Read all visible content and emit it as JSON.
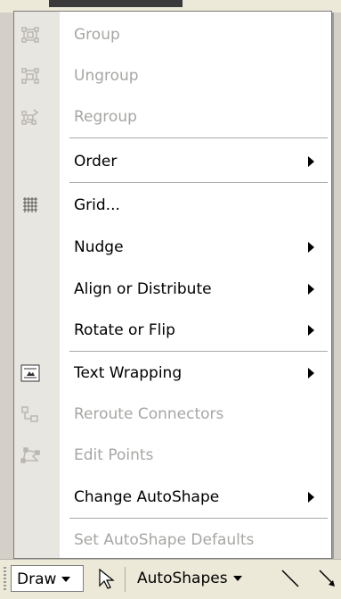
{
  "menu": {
    "items": [
      {
        "label": "Group",
        "icon": "group-icon",
        "disabled": true,
        "submenu": false
      },
      {
        "label": "Ungroup",
        "icon": "ungroup-icon",
        "disabled": true,
        "submenu": false
      },
      {
        "label": "Regroup",
        "icon": "regroup-icon",
        "disabled": true,
        "submenu": false
      },
      {
        "label": "Order",
        "icon": "",
        "disabled": false,
        "submenu": true
      },
      {
        "label": "Grid...",
        "icon": "grid-icon",
        "disabled": false,
        "submenu": false
      },
      {
        "label": "Nudge",
        "icon": "",
        "disabled": false,
        "submenu": true
      },
      {
        "label": "Align or Distribute",
        "icon": "",
        "disabled": false,
        "submenu": true
      },
      {
        "label": "Rotate or Flip",
        "icon": "",
        "disabled": false,
        "submenu": true
      },
      {
        "label": "Text Wrapping",
        "icon": "text-wrapping-icon",
        "disabled": false,
        "submenu": true
      },
      {
        "label": "Reroute Connectors",
        "icon": "reroute-connectors-icon",
        "disabled": true,
        "submenu": false
      },
      {
        "label": "Edit Points",
        "icon": "edit-points-icon",
        "disabled": true,
        "submenu": false
      },
      {
        "label": "Change AutoShape",
        "icon": "",
        "disabled": false,
        "submenu": true
      },
      {
        "label": "Set AutoShape Defaults",
        "icon": "",
        "disabled": true,
        "submenu": false
      }
    ]
  },
  "toolbar": {
    "draw_label": "Draw",
    "autoshapes_label": "AutoShapes",
    "icons": [
      "select-objects-icon",
      "line-icon",
      "arrow-icon"
    ]
  },
  "colors": {
    "disabled_text": "#a7a6a4",
    "gutter": "#e8e6e0",
    "toolbar": "#ece9d8"
  }
}
